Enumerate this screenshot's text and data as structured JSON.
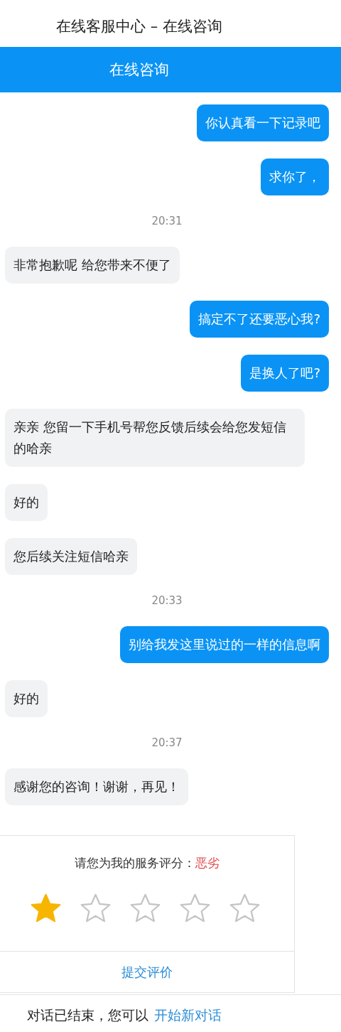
{
  "window": {
    "title": "在线客服中心 – 在线咨询"
  },
  "header": {
    "title": "在线咨询"
  },
  "messages": [
    {
      "kind": "sent",
      "text": "你认真看一下记录吧"
    },
    {
      "kind": "sent",
      "text": "求你了，"
    },
    {
      "kind": "time",
      "text": "20:31"
    },
    {
      "kind": "received",
      "text": "非常抱歉呢 给您带来不便了"
    },
    {
      "kind": "sent",
      "text": "搞定不了还要恶心我?"
    },
    {
      "kind": "sent",
      "text": "是换人了吧?"
    },
    {
      "kind": "received",
      "text": "亲亲 您留一下手机号帮您反馈后续会给您发短信的哈亲"
    },
    {
      "kind": "received",
      "text": "好的"
    },
    {
      "kind": "received",
      "text": "您后续关注短信哈亲"
    },
    {
      "kind": "time",
      "text": "20:33"
    },
    {
      "kind": "sent",
      "text": "别给我发这里说过的一样的信息啊"
    },
    {
      "kind": "received",
      "text": "好的"
    },
    {
      "kind": "time",
      "text": "20:37"
    },
    {
      "kind": "received",
      "text": "感谢您的咨询！谢谢，再见！"
    }
  ],
  "rating": {
    "prompt": "请您为我的服务评分：",
    "verdict": "恶劣",
    "stars": 1,
    "submit": "提交评价"
  },
  "footer": {
    "text": "对话已结束，您可以",
    "link": "开始新对话"
  }
}
